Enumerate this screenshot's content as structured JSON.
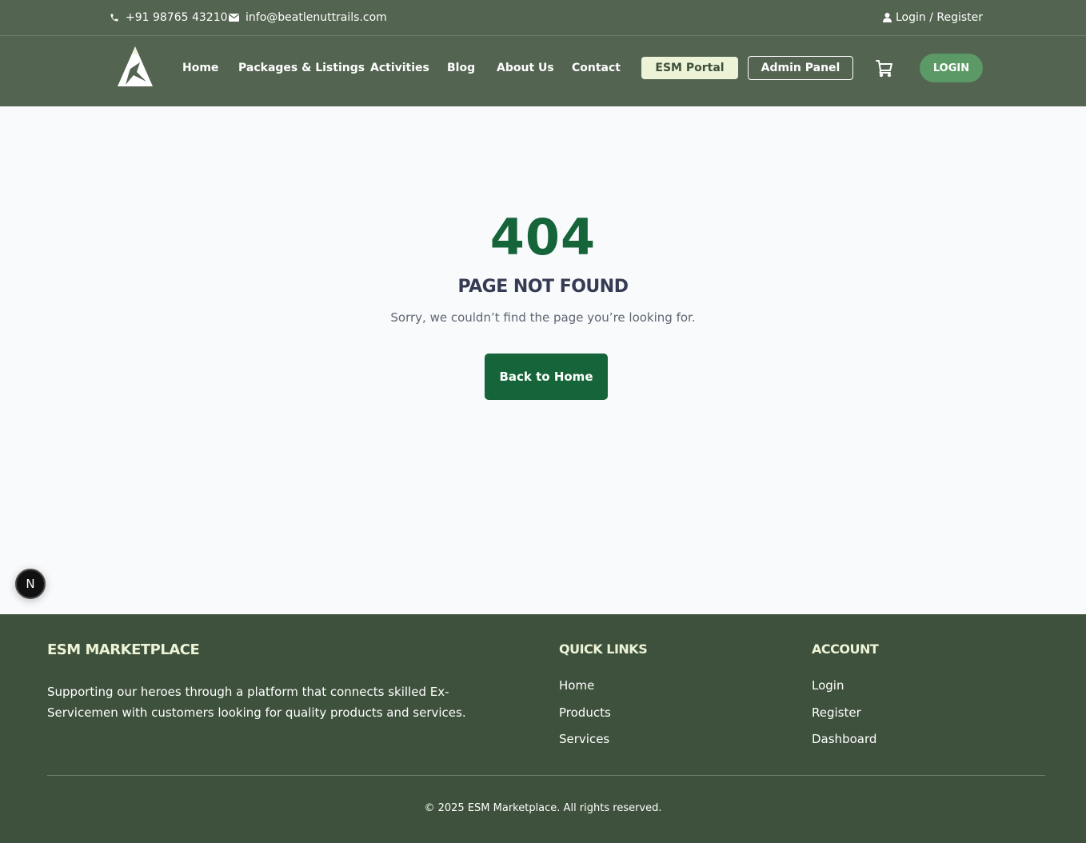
{
  "topbar": {
    "phone": "+91 98765 43210",
    "email": "info@beatlenuttrails.com",
    "auth": "Login / Register"
  },
  "nav": {
    "items": [
      "Home",
      "Packages & Listings",
      "Activities",
      "Blog",
      "About Us",
      "Contact"
    ],
    "esm_portal": "ESM Portal",
    "admin_panel": "Admin Panel",
    "login": "LOGIN"
  },
  "error": {
    "code": "404",
    "title": "PAGE NOT FOUND",
    "message": "Sorry, we couldn’t find the page you’re looking for.",
    "button": "Back to Home"
  },
  "badge": {
    "letter": "N"
  },
  "footer": {
    "brand": "ESM MARKETPLACE",
    "description": "Supporting our heroes through a platform that connects skilled Ex-Servicemen with customers looking for quality products and services.",
    "quick_links": {
      "title": "QUICK LINKS",
      "items": [
        "Home",
        "Products",
        "Services"
      ]
    },
    "account": {
      "title": "ACCOUNT",
      "items": [
        "Login",
        "Register",
        "Dashboard"
      ]
    },
    "copyright": "© 2025 ESM Marketplace. All rights reserved."
  },
  "colors": {
    "header_bg": "#536450",
    "accent_green": "#16653a",
    "login_green": "#5b9a66",
    "footer_bg": "#3e513c",
    "pale_accent": "#ecf3d6"
  },
  "icons": [
    "phone-icon",
    "mail-icon",
    "user-icon",
    "logo-mountain",
    "cart-icon"
  ]
}
